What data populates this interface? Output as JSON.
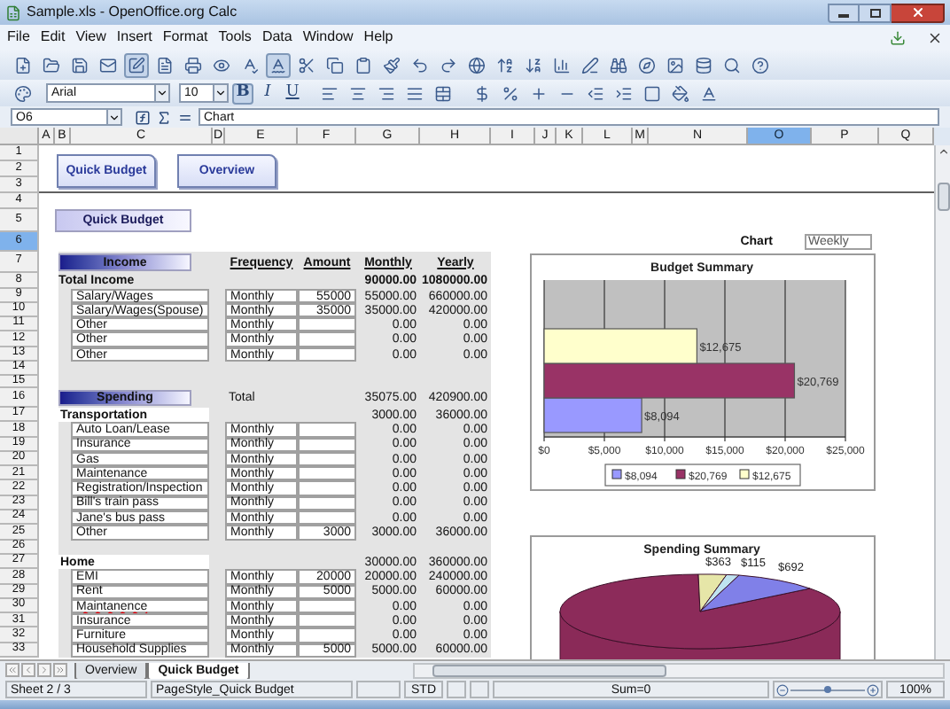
{
  "window": {
    "title": "Sample.xls - OpenOffice.org Calc"
  },
  "menu": [
    "File",
    "Edit",
    "View",
    "Insert",
    "Format",
    "Tools",
    "Data",
    "Window",
    "Help"
  ],
  "toolbar": {
    "edit_file_on": true,
    "autospell_on": true
  },
  "formatting": {
    "font": "Arial",
    "size": "10",
    "styles": [
      {
        "label": "B",
        "selected": true
      },
      {
        "label": "I",
        "selected": false
      },
      {
        "label": "U",
        "selected": false
      }
    ]
  },
  "formula_bar": {
    "cell": "O6",
    "content": "Chart"
  },
  "columns": [
    {
      "label": "A",
      "selected": false
    },
    {
      "label": "B",
      "selected": false
    },
    {
      "label": "C",
      "selected": false
    },
    {
      "label": "D",
      "selected": false
    },
    {
      "label": "E",
      "selected": false
    },
    {
      "label": "F",
      "selected": false
    },
    {
      "label": "G",
      "selected": false
    },
    {
      "label": "H",
      "selected": false
    },
    {
      "label": "I",
      "selected": false
    },
    {
      "label": "J",
      "selected": false
    },
    {
      "label": "K",
      "selected": false
    },
    {
      "label": "L",
      "selected": false
    },
    {
      "label": "M",
      "selected": false
    },
    {
      "label": "N",
      "selected": false
    },
    {
      "label": "O",
      "selected": true
    },
    {
      "label": "P",
      "selected": false
    },
    {
      "label": "Q",
      "selected": false
    }
  ],
  "rows": [
    {
      "label": "1",
      "selected": false
    },
    {
      "label": "2",
      "selected": false
    },
    {
      "label": "3",
      "selected": false
    },
    {
      "label": "4",
      "selected": false
    },
    {
      "label": "5",
      "selected": false
    },
    {
      "label": "6",
      "selected": true
    },
    {
      "label": "7",
      "selected": false
    },
    {
      "label": "8",
      "selected": false
    },
    {
      "label": "9",
      "selected": false
    },
    {
      "label": "10",
      "selected": false
    },
    {
      "label": "11",
      "selected": false
    },
    {
      "label": "12",
      "selected": false
    },
    {
      "label": "13",
      "selected": false
    },
    {
      "label": "14",
      "selected": false
    },
    {
      "label": "15",
      "selected": false
    },
    {
      "label": "16",
      "selected": false
    },
    {
      "label": "17",
      "selected": false
    },
    {
      "label": "18",
      "selected": false
    },
    {
      "label": "19",
      "selected": false
    },
    {
      "label": "20",
      "selected": false
    },
    {
      "label": "21",
      "selected": false
    },
    {
      "label": "22",
      "selected": false
    },
    {
      "label": "23",
      "selected": false
    },
    {
      "label": "24",
      "selected": false
    },
    {
      "label": "25",
      "selected": false
    },
    {
      "label": "26",
      "selected": false
    },
    {
      "label": "27",
      "selected": false
    },
    {
      "label": "28",
      "selected": false
    },
    {
      "label": "29",
      "selected": false
    },
    {
      "label": "30",
      "selected": false
    },
    {
      "label": "31",
      "selected": false
    },
    {
      "label": "32",
      "selected": false
    },
    {
      "label": "33",
      "selected": false
    }
  ],
  "nav_buttons": [
    "Quick Budget",
    "Overview"
  ],
  "title_box": "Quick Budget",
  "income": {
    "header": "Income",
    "columns": [
      "Frequency",
      "Amount",
      "Monthly",
      "Yearly"
    ],
    "total": {
      "label": "Total Income",
      "monthly": "90000.00",
      "yearly": "1080000.00"
    },
    "items": [
      {
        "label": "Salary/Wages",
        "frequency": "Monthly",
        "amount": "55000",
        "monthly": "55000.00",
        "yearly": "660000.00",
        "misspelled": false
      },
      {
        "label": "Salary/Wages(Spouse)",
        "frequency": "Monthly",
        "amount": "35000",
        "monthly": "35000.00",
        "yearly": "420000.00",
        "misspelled": false
      },
      {
        "label": "Other",
        "frequency": "Monthly",
        "monthly": "0.00",
        "yearly": "0.00",
        "misspelled": false
      },
      {
        "label": "Other",
        "frequency": "Monthly",
        "monthly": "0.00",
        "yearly": "0.00",
        "misspelled": false
      },
      {
        "label": "Other",
        "frequency": "Monthly",
        "monthly": "0.00",
        "yearly": "0.00",
        "misspelled": false
      }
    ]
  },
  "spending": {
    "header": "Spending",
    "total": {
      "label": "Total",
      "monthly": "35075.00",
      "yearly": "420900.00"
    },
    "groups": [
      {
        "name": "Transportation",
        "monthly": "3000.00",
        "yearly": "36000.00",
        "items": [
          {
            "label": "Auto Loan/Lease",
            "frequency": "Monthly",
            "monthly": "0.00",
            "yearly": "0.00",
            "misspelled": false
          },
          {
            "label": "Insurance",
            "frequency": "Monthly",
            "monthly": "0.00",
            "yearly": "0.00",
            "misspelled": false
          },
          {
            "label": "Gas",
            "frequency": "Monthly",
            "monthly": "0.00",
            "yearly": "0.00",
            "misspelled": false
          },
          {
            "label": "Maintenance",
            "frequency": "Monthly",
            "monthly": "0.00",
            "yearly": "0.00",
            "misspelled": false
          },
          {
            "label": "Registration/Inspection",
            "frequency": "Monthly",
            "monthly": "0.00",
            "yearly": "0.00",
            "misspelled": false
          },
          {
            "label": "Bill's train pass",
            "frequency": "Monthly",
            "monthly": "0.00",
            "yearly": "0.00",
            "misspelled": false
          },
          {
            "label": "Jane's bus pass",
            "frequency": "Monthly",
            "monthly": "0.00",
            "yearly": "0.00",
            "misspelled": false
          },
          {
            "label": "Other",
            "frequency": "Monthly",
            "amount": "3000",
            "monthly": "3000.00",
            "yearly": "36000.00",
            "misspelled": false
          }
        ]
      },
      {
        "name": "Home",
        "monthly": "30000.00",
        "yearly": "360000.00",
        "items": [
          {
            "label": "EMI",
            "frequency": "Monthly",
            "amount": "20000",
            "monthly": "20000.00",
            "yearly": "240000.00",
            "misspelled": false
          },
          {
            "label": "Rent",
            "frequency": "Monthly",
            "amount": "5000",
            "monthly": "5000.00",
            "yearly": "60000.00",
            "misspelled": false
          },
          {
            "label": "Maintanence",
            "frequency": "Monthly",
            "monthly": "0.00",
            "yearly": "0.00",
            "misspelled": true
          },
          {
            "label": "Insurance",
            "frequency": "Monthly",
            "monthly": "0.00",
            "yearly": "0.00",
            "misspelled": false
          },
          {
            "label": "Furniture",
            "frequency": "Monthly",
            "monthly": "0.00",
            "yearly": "0.00",
            "misspelled": false
          },
          {
            "label": "Household Supplies",
            "frequency": "Monthly",
            "amount": "5000",
            "monthly": "5000.00",
            "yearly": "60000.00",
            "misspelled": false
          }
        ]
      }
    ]
  },
  "chart_selector": {
    "label": "Chart",
    "value": "Weekly"
  },
  "budget_chart": {
    "chart_data": {
      "type": "bar",
      "orientation": "horizontal",
      "title": "Budget Summary",
      "series": [
        {
          "name": "$8,094",
          "color": "#9999ff",
          "values": [
            8094
          ]
        },
        {
          "name": "$20,769",
          "color": "#993366",
          "values": [
            20769
          ]
        },
        {
          "name": "$12,675",
          "color": "#ffffcc",
          "values": [
            12675
          ]
        }
      ],
      "grid": true,
      "legend": "bottom",
      "xlim": [
        0,
        25000
      ],
      "xticks": [
        {
          "value": 0,
          "label": "$0"
        },
        {
          "value": 5000,
          "label": "$5,000"
        },
        {
          "value": 10000,
          "label": "$10,000"
        },
        {
          "value": 15000,
          "label": "$15,000"
        },
        {
          "value": 20000,
          "label": "$20,000"
        },
        {
          "value": 25000,
          "label": "$25,000"
        }
      ],
      "value_labels": [
        [
          "$8,094"
        ],
        [
          "$20,769"
        ],
        [
          "$12,675"
        ]
      ]
    }
  },
  "spending_chart": {
    "title": "Spending Summary",
    "data_labels": [
      "$363",
      "$115",
      "$692"
    ]
  },
  "sheet_tabs": [
    {
      "label": "Overview",
      "selected": false
    },
    {
      "label": "Quick Budget",
      "selected": true
    }
  ],
  "status_bar": {
    "sheet": "Sheet 2 / 3",
    "page_style": "PageStyle_Quick Budget",
    "mode": "STD",
    "sum": "Sum=0",
    "zoom_slider": {
      "level": 0.5
    },
    "zoom": "100%"
  }
}
